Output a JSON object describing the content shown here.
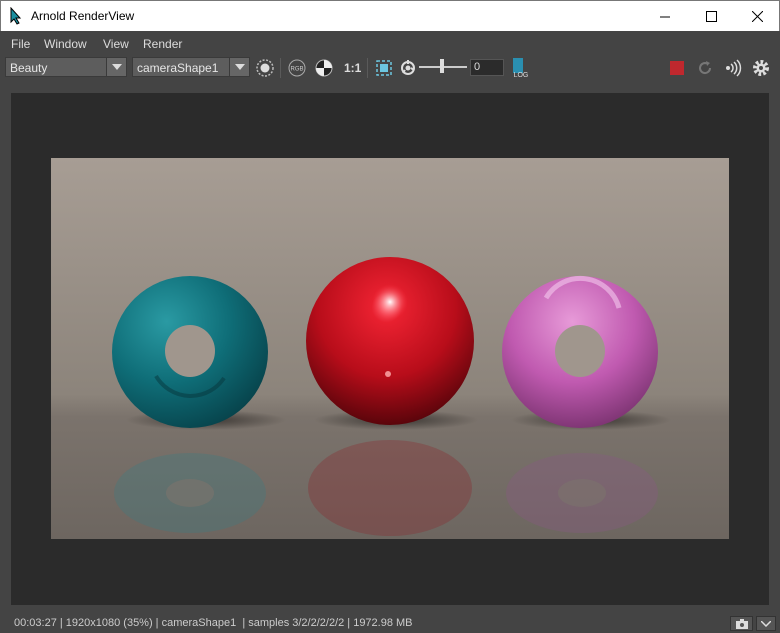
{
  "window": {
    "title": "Arnold RenderView"
  },
  "menu": {
    "items": [
      "File",
      "Window",
      "View",
      "Render"
    ]
  },
  "toolbar": {
    "aov_selected": "Beauty",
    "camera_selected": "cameraShape1",
    "ratio_label": "1:1",
    "exposure_value": "0",
    "log_label": "LOG"
  },
  "icons": {
    "app": "arnold-icon",
    "display_settings": "radial-icon",
    "rgb": "rgb-icon",
    "alpha": "checker-icon",
    "crop": "crop-region-icon",
    "exposure": "aperture-icon",
    "log": "log-icon",
    "stop": "stop-icon",
    "refresh": "refresh-icon",
    "ipr": "ipr-icon",
    "settings": "gear-icon",
    "snapshot": "camera-icon",
    "expand": "chevron-down-icon"
  },
  "colors": {
    "stop": "#c0282e",
    "teal_torus": "#0f6e78",
    "red_sphere": "#c8101c",
    "magenta_torus": "#c860b8",
    "background_wall": "#a49a90"
  },
  "status": {
    "text": "00:03:27 | 1920x1080 (35%) | cameraShape1  | samples 3/2/2/2/2/2 | 1972.98 MB"
  }
}
